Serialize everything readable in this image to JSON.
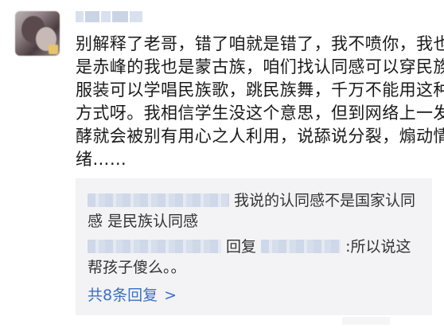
{
  "comment": {
    "username": "",
    "body_lines": [
      "别解释了老哥，错了咱就是错了，我不喷你，我也",
      "是赤峰的我也是蒙古族，咱们找认同感可以穿民族",
      "服装可以学唱民族歌，跳民族舞，千万不能用这种",
      "方式呀。我相信学生没这个意思，但到网络上一发",
      "酵就会被别有用心之人利用，说舔说分裂，煽动情",
      "绪……"
    ]
  },
  "replies": [
    {
      "line1": "我说的认同感不是国家认同",
      "line2": "感 是民族认同感"
    },
    {
      "reply_word": "回复",
      "line1_tail": ":所以说这",
      "line2": "帮孩子傻么。。"
    }
  ],
  "more_replies": {
    "label": "共8条回复",
    "chevron": ">"
  },
  "colors": {
    "link": "#3b6fc4",
    "reply_bg": "#f3f3f5",
    "text": "#1a1a1a"
  },
  "icons": [
    "avatar",
    "chevron-right-icon"
  ]
}
